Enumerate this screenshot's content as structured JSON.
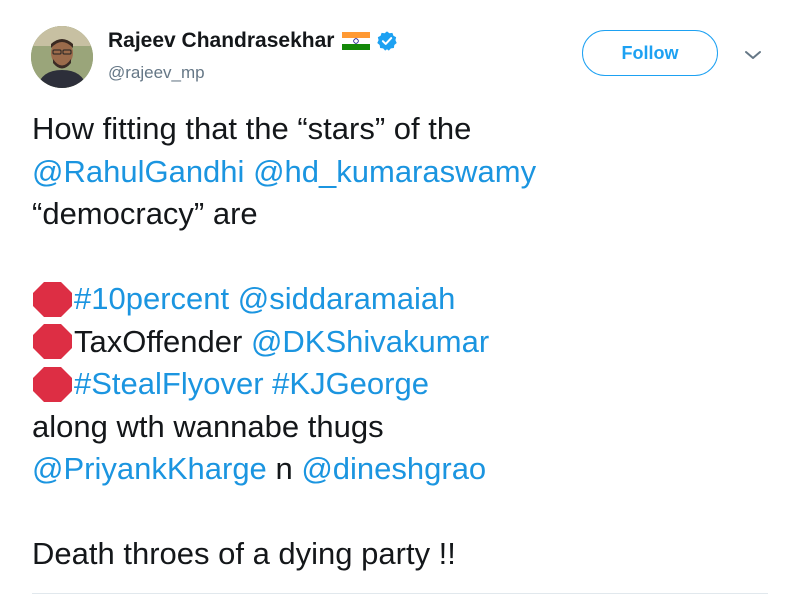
{
  "author": {
    "name": "Rajeev Chandrasekhar",
    "handle": "@rajeev_mp"
  },
  "header": {
    "follow_label": "Follow"
  },
  "icons": {
    "flag": "india-flag-icon",
    "verified": "verified-badge-icon",
    "caret": "chevron-down-icon",
    "stop": "stop-sign-emoji-icon"
  },
  "colors": {
    "link": "#1b95e0",
    "follow_border": "#1da1f2",
    "verified": "#1da1f2",
    "stop": "#dd2e44"
  },
  "tweet": {
    "line1": "How fitting that the “stars” of the",
    "line2_mention1": "@RahulGandhi",
    "line2_mention2": "@hd_kumaraswamy",
    "line3": "“democracy” are",
    "line5_hashtag": "#10percent",
    "line5_mention": "@siddaramaiah",
    "line6_text": "TaxOffender",
    "line6_mention": "@DKShivakumar",
    "line7_hashtag1": "#StealFlyover",
    "line7_hashtag2": "#KJGeorge",
    "line8": "along wth wannabe thugs",
    "line9_mention1": "@PriyankKharge",
    "line9_conj": "n",
    "line9_mention2": "@dineshgrao",
    "line11": "Death throes of a dying party !!"
  }
}
